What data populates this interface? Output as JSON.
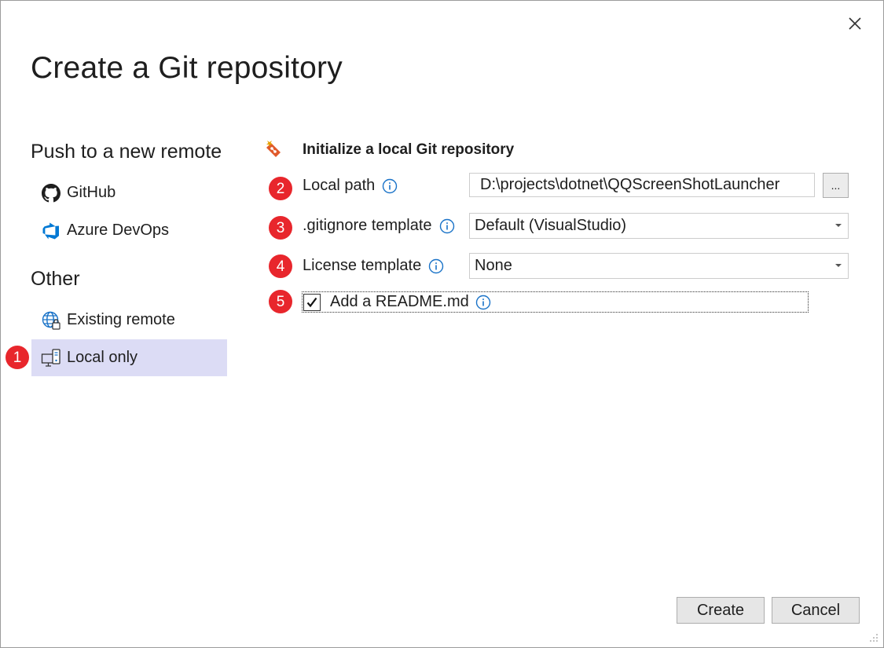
{
  "dialog": {
    "title": "Create a Git repository"
  },
  "sidebar": {
    "push_heading": "Push to a new remote",
    "other_heading": "Other",
    "items": [
      {
        "label": "GitHub",
        "icon": "github-icon"
      },
      {
        "label": "Azure DevOps",
        "icon": "azure-devops-icon"
      },
      {
        "label": "Existing remote",
        "icon": "globe-icon"
      },
      {
        "label": "Local only",
        "icon": "local-computer-icon",
        "selected": true
      }
    ]
  },
  "main": {
    "section_title": "Initialize a local Git repository",
    "local_path": {
      "label": "Local path",
      "value": "D:\\projects\\dotnet\\QQScreenShotLauncher",
      "browse_label": "..."
    },
    "gitignore": {
      "label": ".gitignore template",
      "selected": "Default (VisualStudio)"
    },
    "license": {
      "label": "License template",
      "selected": "None"
    },
    "readme": {
      "label": "Add a README.md",
      "checked": true
    }
  },
  "badges": [
    "1",
    "2",
    "3",
    "4",
    "5"
  ],
  "footer": {
    "create_label": "Create",
    "cancel_label": "Cancel"
  },
  "colors": {
    "accent": "#1a73c8",
    "badge": "#e8262c",
    "selected_bg": "#dcdcf5",
    "azure": "#0078d4"
  }
}
